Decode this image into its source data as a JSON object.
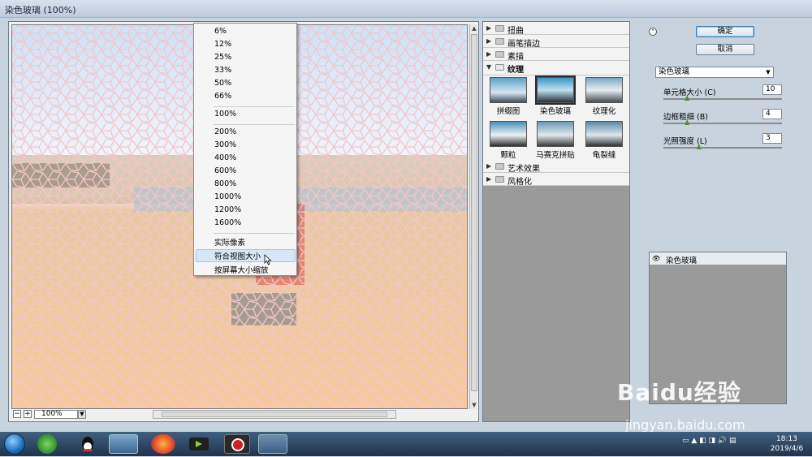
{
  "window": {
    "title": "染色玻璃 (100%)"
  },
  "canvas": {
    "zoom_value": "100%",
    "zoom_minus": "−",
    "zoom_plus": "+"
  },
  "zoom_menu": {
    "items": [
      "6%",
      "12%",
      "25%",
      "33%",
      "50%",
      "66%",
      "100%",
      "200%",
      "300%",
      "400%",
      "600%",
      "800%",
      "1000%",
      "1200%",
      "1600%",
      "实际像素",
      "符合视图大小",
      "按屏幕大小缩放"
    ],
    "highlighted": "符合视图大小"
  },
  "filter_gallery": {
    "categories_top": [
      {
        "label": "扭曲",
        "expanded": false
      },
      {
        "label": "画笔描边",
        "expanded": false
      },
      {
        "label": "素描",
        "expanded": false
      },
      {
        "label": "纹理",
        "expanded": true
      }
    ],
    "texture_filters": [
      {
        "label": "拼缀图",
        "selected": false
      },
      {
        "label": "染色玻璃",
        "selected": true
      },
      {
        "label": "纹理化",
        "selected": false
      },
      {
        "label": "颗粒",
        "selected": false
      },
      {
        "label": "马赛克拼贴",
        "selected": false
      },
      {
        "label": "龟裂缝",
        "selected": false
      }
    ],
    "categories_bottom": [
      {
        "label": "艺术效果",
        "expanded": false
      },
      {
        "label": "风格化",
        "expanded": false
      }
    ]
  },
  "settings": {
    "ok_label": "确定",
    "cancel_label": "取消",
    "filter_select": "染色玻璃",
    "params": [
      {
        "label": "单元格大小 (C)",
        "value": "10",
        "fraction": 0.2
      },
      {
        "label": "边框粗细 (B)",
        "value": "4",
        "fraction": 0.2
      },
      {
        "label": "光照强度 (L)",
        "value": "3",
        "fraction": 0.3
      }
    ],
    "layer_name": "染色玻璃"
  },
  "taskbar": {
    "time": "18:13",
    "date": "2019/4/6"
  },
  "watermark": {
    "brand": "Baidu经验",
    "url": "jingyan.baidu.com"
  },
  "colors": {
    "accent": "#3c7fb1",
    "menu_highlight": "#d9e6f5",
    "slider_knob": "#4e8d3b"
  }
}
